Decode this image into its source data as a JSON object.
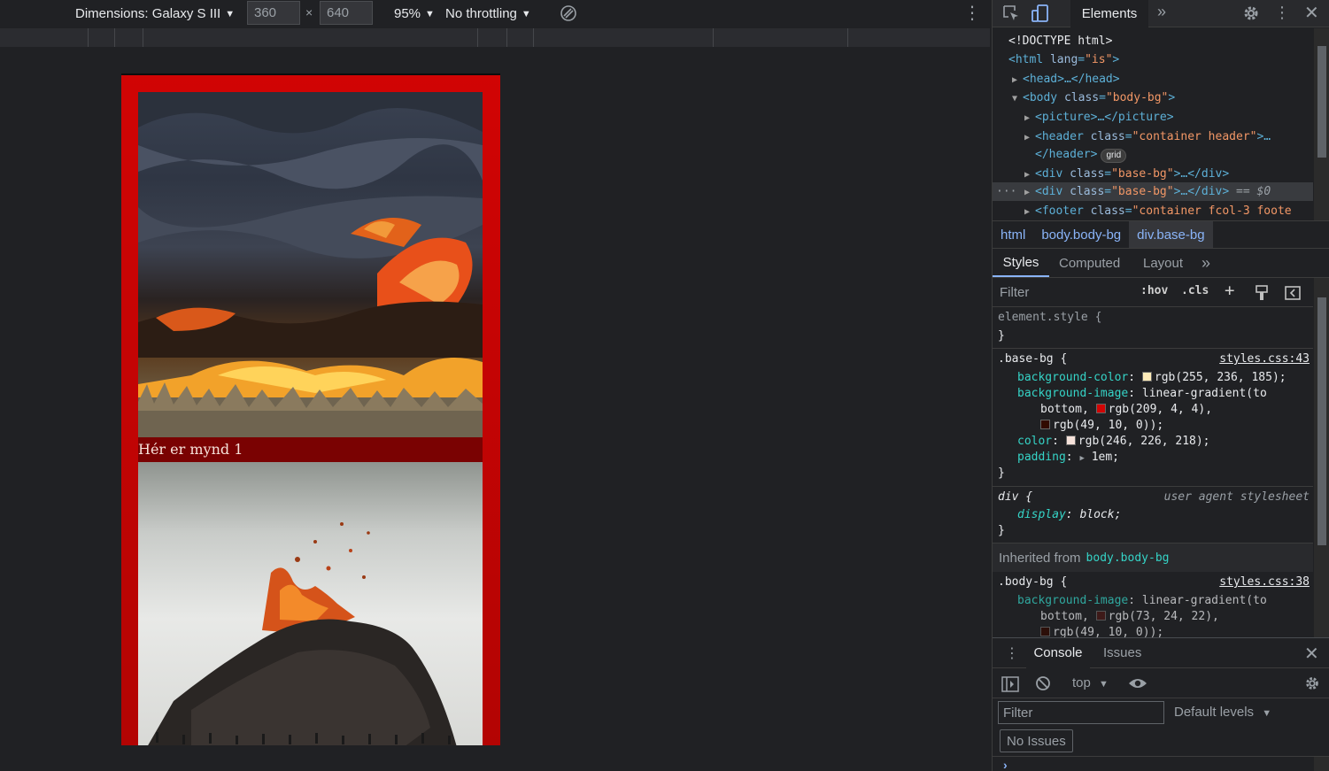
{
  "device_toolbar": {
    "dimensions_label": "Dimensions: Galaxy S III",
    "width_value": "360",
    "height_value": "640",
    "times_symbol": "×",
    "zoom": "95%",
    "throttling": "No throttling"
  },
  "page": {
    "caption": "Hér er mynd 1"
  },
  "devtools": {
    "main_tab": "Elements",
    "dom_lines": {
      "doctype": "<!DOCTYPE html>",
      "html_open_tag": "<html",
      "html_attr": "lang",
      "html_val": "\"is\"",
      "html_close": ">",
      "head": "<head>…</head>",
      "body_open": "<body",
      "body_attr": "class",
      "body_val": "\"body-bg\"",
      "body_close": ">",
      "picture": "<picture>…</picture>",
      "header_open": "<header",
      "header_attr": "class",
      "header_val": "\"container header\"",
      "header_ellipsis": ">…",
      "header_close": "</header>",
      "grid_badge": "grid",
      "div_open": "<div",
      "div_attr": "class",
      "div_val": "\"base-bg\"",
      "div_close": ">…</div>",
      "selected_marker": "== $0",
      "footer_open": "<footer",
      "footer_attr": "class",
      "footer_val": "\"container fcol-3 foote",
      "dots": "···"
    },
    "breadcrumb": [
      "html",
      "body.body-bg",
      "div.base-bg"
    ],
    "styles_tabs": [
      "Styles",
      "Computed",
      "Layout"
    ],
    "filter_placeholder": "Filter",
    "hov": ":hov",
    "cls": ".cls",
    "rules": {
      "element_style": "element.style {",
      "close_brace": "}",
      "base_bg_selector": ".base-bg {",
      "base_bg_source": "styles.css:43",
      "bg_color_prop": "background-color",
      "bg_color_val": "rgb(255, 236, 185);",
      "bg_color_swatch": "#ffecb9",
      "bg_image_prop": "background-image",
      "bg_image_val": "linear-gradient(to",
      "bottom_word": "bottom,",
      "red_val": "rgb(209, 4, 4),",
      "red_swatch": "#d10404",
      "dark_val": "rgb(49, 10, 0));",
      "dark_swatch": "#310a00",
      "color_prop": "color",
      "color_val": "rgb(246, 226, 218);",
      "color_swatch": "#f6e2da",
      "padding_prop": "padding",
      "padding_val": "1em;",
      "div_selector": "div {",
      "ua_label": "user agent stylesheet",
      "display_prop": "display",
      "display_val": "block;",
      "inherited_label": "Inherited from",
      "inherited_link": "body.body-bg",
      "body_bg_selector": ".body-bg {",
      "body_bg_source": "styles.css:38",
      "body_bg_image_prop": "background-image",
      "body_bg_image_val": "linear-gradient(to",
      "body_bottom_word": "bottom,",
      "body_red_val": "rgb(73, 24, 22),",
      "body_red_swatch": "#491816",
      "body_dark_val": "rgb(49, 10, 0));",
      "body_dark_swatch": "#310a00"
    },
    "console": {
      "tab_console": "Console",
      "tab_issues": "Issues",
      "context": "top",
      "filter_placeholder": "Filter",
      "levels": "Default levels",
      "no_issues": "No Issues",
      "prompt": "›"
    }
  }
}
